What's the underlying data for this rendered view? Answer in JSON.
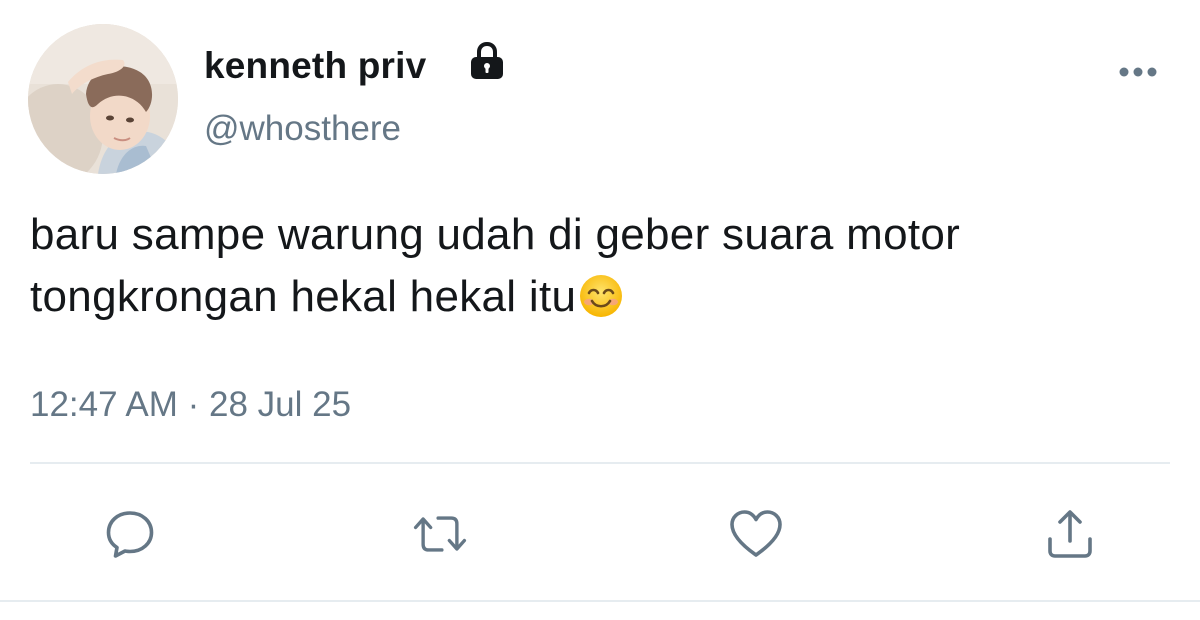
{
  "user": {
    "display_name": "kenneth priv",
    "handle": "@whosthere",
    "protected_icon": "lock-icon",
    "avatar": "profile-photo"
  },
  "tweet": {
    "lines": [
      "baru sampe warung udah di geber suara motor",
      "tongkrongan hekal hekal itu"
    ],
    "trailing_emoji": "smiling-face-with-smiling-eyes-emoji",
    "timestamp": "12:47 AM · 28 Jul 25"
  },
  "actions": {
    "reply_icon": "reply-icon",
    "retweet_icon": "retweet-icon",
    "like_icon": "heart-icon",
    "share_icon": "share-icon",
    "more_icon": "more-icon"
  },
  "colors": {
    "text": "#14171a",
    "secondary": "#657786",
    "divider": "#e6ecf0",
    "background": "#ffffff"
  }
}
